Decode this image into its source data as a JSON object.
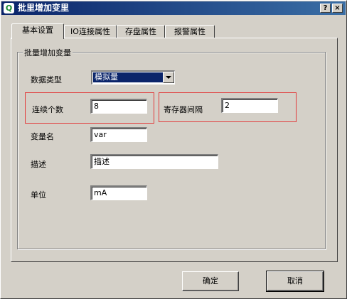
{
  "window": {
    "title": "批里增加变里",
    "help_label": "?",
    "close_label": "×",
    "app_icon_glyph": "Q"
  },
  "tabs": [
    {
      "label": "基本设置",
      "active": true
    },
    {
      "label": "IO连接属性",
      "active": false
    },
    {
      "label": "存盘属性",
      "active": false
    },
    {
      "label": "报警属性",
      "active": false
    }
  ],
  "group": {
    "title": "批量增加变量",
    "data_type": {
      "label": "数据类型",
      "value": "模拟量"
    },
    "count": {
      "label": "连续个数",
      "value": "8"
    },
    "register_interval": {
      "label": "寄存器间隔",
      "value": "2"
    },
    "var_name": {
      "label": "变量名",
      "value": "var"
    },
    "description": {
      "label": "描述",
      "value": "描述"
    },
    "unit": {
      "label": "单位",
      "value": "mA"
    }
  },
  "buttons": {
    "ok": "确定",
    "cancel": "取消"
  },
  "colors": {
    "title_bar": "#0a246a",
    "dialog_bg": "#d4d0c8",
    "highlight_box": "#e23b3b",
    "combo_selected": "#0a246a"
  }
}
